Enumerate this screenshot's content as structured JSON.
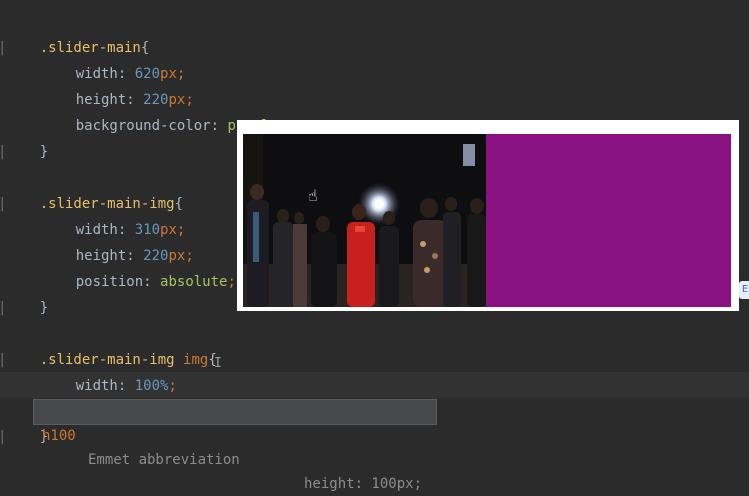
{
  "code": {
    "rule1": {
      "selector": ".slider-main",
      "open": "{",
      "props": [
        {
          "name": "width",
          "num": "620",
          "unit": "px"
        },
        {
          "name": "height",
          "num": "220",
          "unit": "px"
        },
        {
          "name": "background-color",
          "value": "purple"
        }
      ],
      "close": "}"
    },
    "rule2": {
      "selector": ".slider-main-img",
      "open": "{",
      "props": [
        {
          "name": "width",
          "num": "310",
          "unit": "px"
        },
        {
          "name": "height",
          "num": "220",
          "unit": "px"
        },
        {
          "name": "position",
          "value": "absolute"
        }
      ],
      "close": "}"
    },
    "rule3": {
      "selector": ".slider-main-img",
      "tag": "img",
      "open": "{",
      "props": [
        {
          "name": "width",
          "num": "100",
          "unit": "%"
        }
      ],
      "typing": "h100",
      "close": "}"
    },
    "colon": ":",
    "semicolon": ";"
  },
  "completion": {
    "abbreviation": "h100",
    "description": "Emmet abbreviation",
    "result": "height: 100px;"
  },
  "preview": {
    "background_color": "#8a1180"
  },
  "side_tab": {
    "label": "E"
  },
  "icons": {
    "mouse_pointer": "hand-pointer-icon",
    "text_cursor": "i-beam-icon"
  }
}
